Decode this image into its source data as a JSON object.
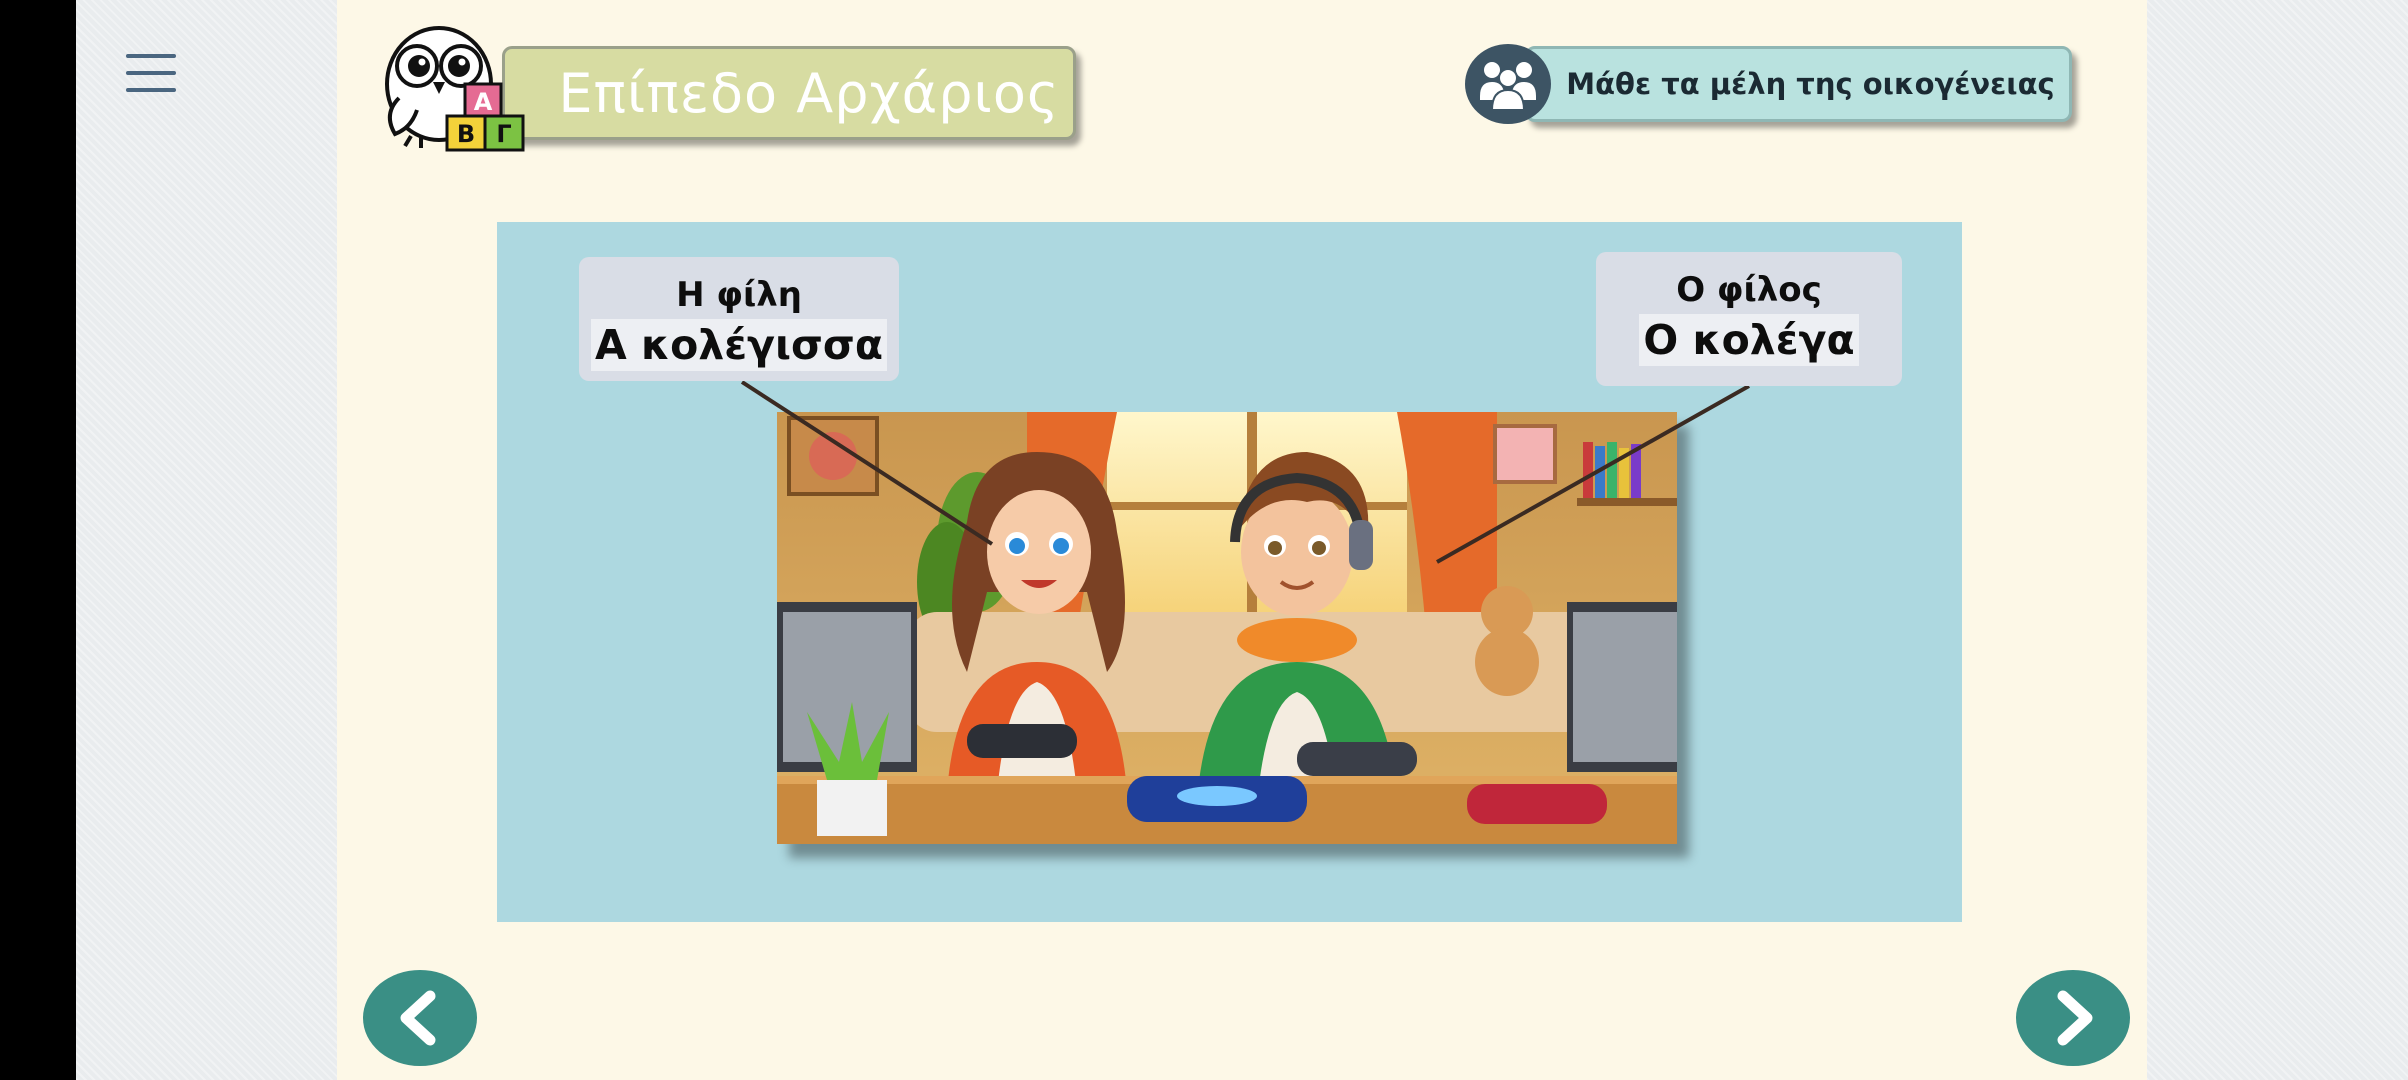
{
  "header": {
    "level_title": "Επίπεδο Αρχάριος",
    "logo_blocks": [
      "Α",
      "Β",
      "Γ"
    ],
    "family_button_label": "Μάθε τα μέλη της οικογένειας"
  },
  "panel": {
    "left_label": {
      "article_form": "Η φίλη",
      "dialect_form": "Α κολέγισσα"
    },
    "right_label": {
      "article_form": "Ο φίλος",
      "dialect_form": "Ο κολέγα"
    }
  },
  "icons": {
    "menu": "hamburger-menu-icon",
    "family": "family-group-icon",
    "prev": "chevron-left-icon",
    "next": "chevron-right-icon"
  },
  "colors": {
    "page_bg": "#fdf8e7",
    "banner": "#d7dca2",
    "family_pill": "#b9e2df",
    "panel": "#add8e0",
    "nav": "#3a8f85",
    "icon_dark": "#3d5464"
  }
}
